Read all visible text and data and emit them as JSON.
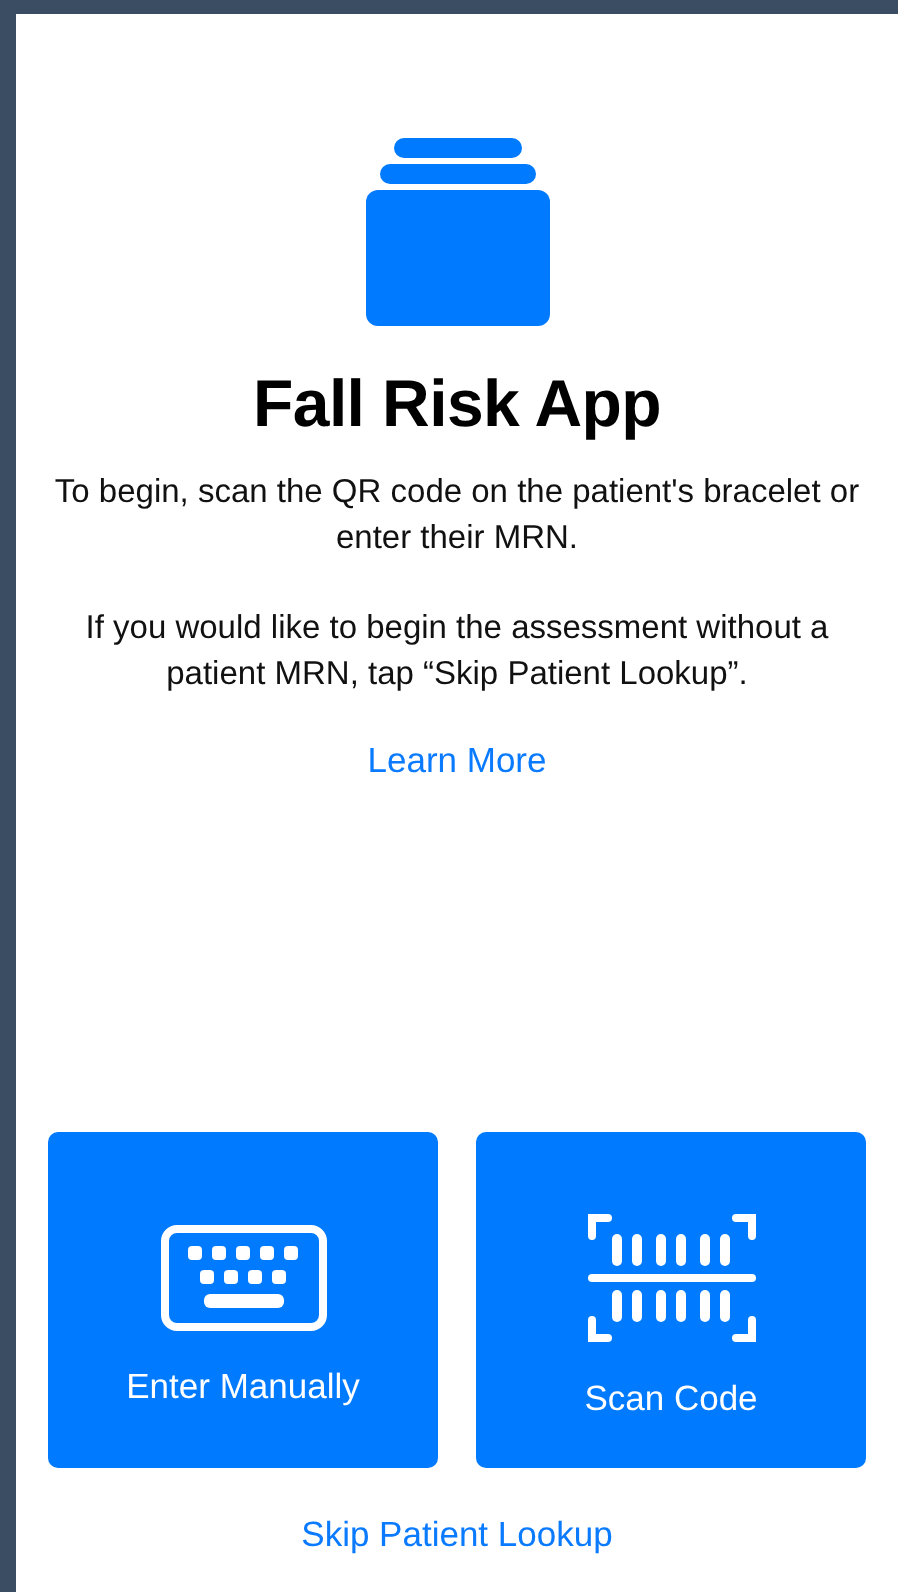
{
  "title": "Fall Risk App",
  "paragraphs": [
    "To begin, scan the QR code on the patient's bracelet or enter their MRN.",
    "If you would like to begin the assessment without a patient MRN, tap “Skip Patient Lookup”."
  ],
  "learn_more": "Learn More",
  "actions": [
    {
      "kind": "keyboard",
      "label": "Enter Manually"
    },
    {
      "kind": "scan",
      "label": "Scan Code"
    }
  ],
  "skip_link": "Skip Patient Lookup"
}
